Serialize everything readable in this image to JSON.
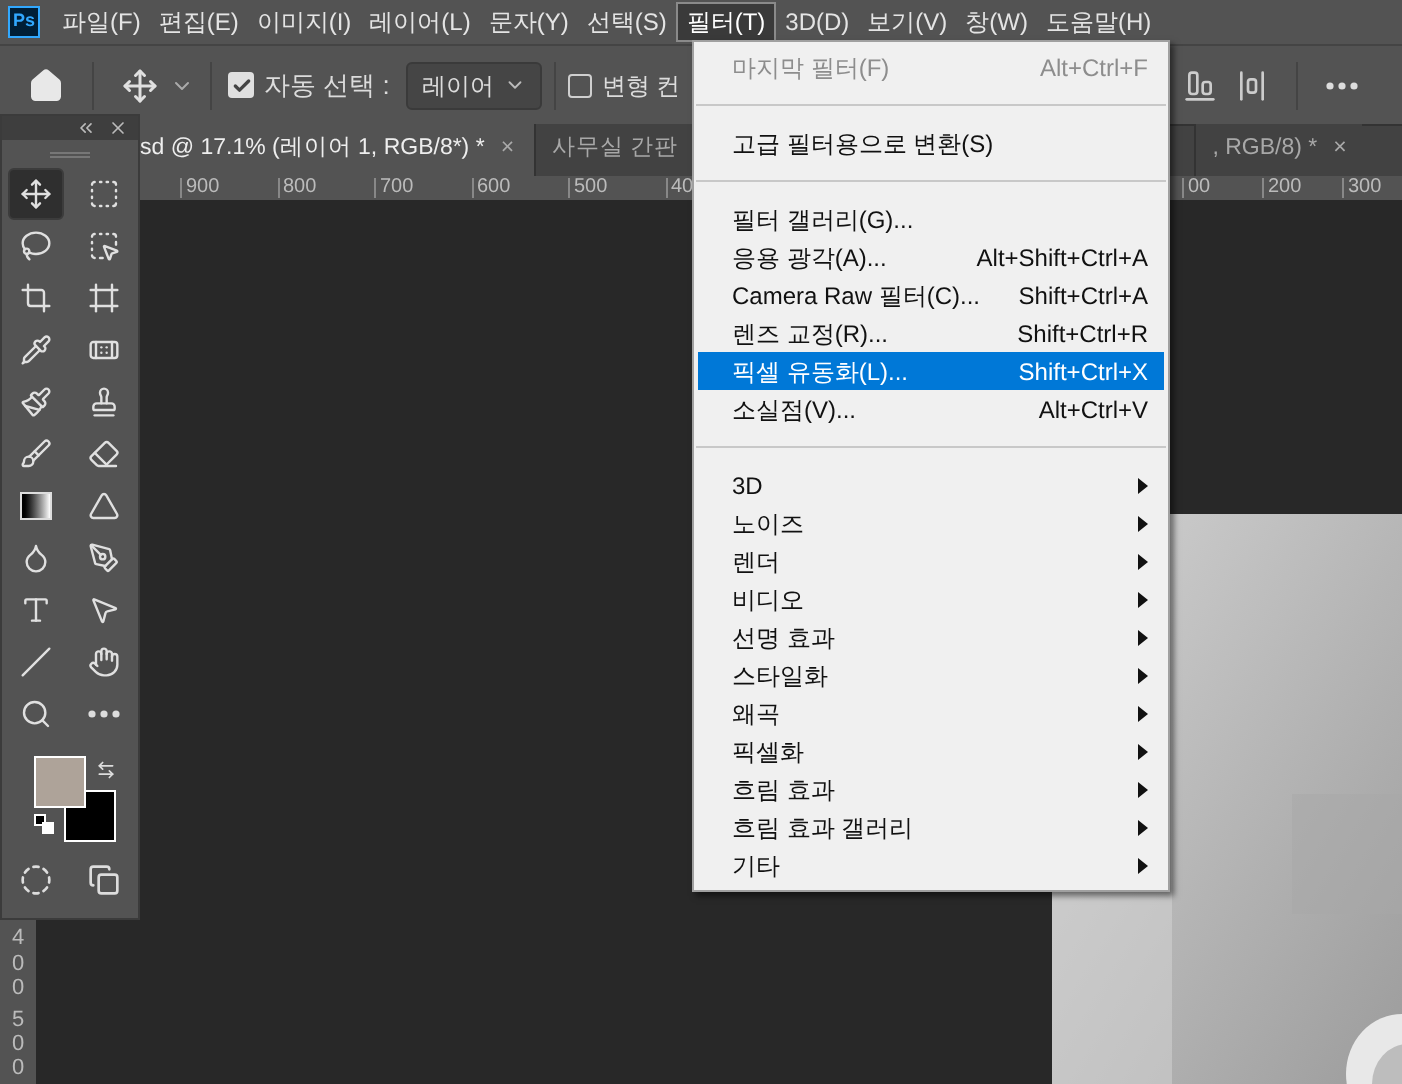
{
  "app_logo": "Ps",
  "menubar": [
    {
      "label": "파일(F)",
      "selected": false
    },
    {
      "label": "편집(E)",
      "selected": false
    },
    {
      "label": "이미지(I)",
      "selected": false
    },
    {
      "label": "레이어(L)",
      "selected": false
    },
    {
      "label": "문자(Y)",
      "selected": false
    },
    {
      "label": "선택(S)",
      "selected": false
    },
    {
      "label": "필터(T)",
      "selected": true
    },
    {
      "label": "3D(D)",
      "selected": false
    },
    {
      "label": "보기(V)",
      "selected": false
    },
    {
      "label": "창(W)",
      "selected": false
    },
    {
      "label": "도움말(H)",
      "selected": false
    }
  ],
  "options_bar": {
    "auto_select": {
      "label": "자동 선택 :",
      "checked": true
    },
    "auto_select_target": "레이어",
    "transform_controls": {
      "label": "변형 컨",
      "checked": false
    }
  },
  "document_tabs": [
    {
      "label": "sd @ 17.1% (레이어 1, RGB/8*) *",
      "close": "×",
      "selected": true
    },
    {
      "label": "사무실 간판",
      "selected": false
    },
    {
      "label": ", RGB/8) *",
      "close": "×",
      "selected": false
    }
  ],
  "ruler_left_labels": [
    "900",
    "800",
    "700",
    "600",
    "500",
    "40"
  ],
  "ruler_right_labels": [
    "00",
    "200",
    "300"
  ],
  "vertical_ruler_labels": [
    "400",
    "500"
  ],
  "toolbox": {
    "tools": [
      {
        "kind": "move",
        "selected": true
      },
      {
        "kind": "marquee",
        "selected": false
      },
      {
        "kind": "lasso",
        "selected": false
      },
      {
        "kind": "object-select",
        "selected": false
      },
      {
        "kind": "crop",
        "selected": false
      },
      {
        "kind": "frame",
        "selected": false
      },
      {
        "kind": "eyedropper",
        "selected": false
      },
      {
        "kind": "patch",
        "selected": false
      },
      {
        "kind": "brush",
        "selected": false
      },
      {
        "kind": "stamp",
        "selected": false
      },
      {
        "kind": "history-brush",
        "selected": false
      },
      {
        "kind": "eraser",
        "selected": false
      },
      {
        "kind": "gradient",
        "selected": false
      },
      {
        "kind": "triangle",
        "selected": false
      },
      {
        "kind": "smudge",
        "selected": false
      },
      {
        "kind": "pen",
        "selected": false
      },
      {
        "kind": "type",
        "selected": false
      },
      {
        "kind": "pointer",
        "selected": false
      },
      {
        "kind": "line",
        "selected": false
      },
      {
        "kind": "hand",
        "selected": false
      },
      {
        "kind": "zoom",
        "selected": false
      },
      {
        "kind": "more",
        "selected": false
      }
    ]
  },
  "filter_menu": [
    {
      "kind": "item",
      "label": "마지막 필터(F)",
      "shortcut": "Alt+Ctrl+F",
      "disabled": true,
      "selected": false
    },
    {
      "kind": "separator"
    },
    {
      "kind": "item",
      "label": "고급 필터용으로 변환(S)",
      "disabled": false,
      "selected": false
    },
    {
      "kind": "separator"
    },
    {
      "kind": "item",
      "label": "필터 갤러리(G)...",
      "disabled": false,
      "selected": false
    },
    {
      "kind": "item",
      "label": "응용 광각(A)...",
      "shortcut": "Alt+Shift+Ctrl+A",
      "disabled": false,
      "selected": false
    },
    {
      "kind": "item",
      "label": "Camera Raw 필터(C)...",
      "shortcut": "Shift+Ctrl+A",
      "disabled": false,
      "selected": false
    },
    {
      "kind": "item",
      "label": "렌즈 교정(R)...",
      "shortcut": "Shift+Ctrl+R",
      "disabled": false,
      "selected": false
    },
    {
      "kind": "item",
      "label": "픽셀 유동화(L)...",
      "shortcut": "Shift+Ctrl+X",
      "disabled": false,
      "selected": true
    },
    {
      "kind": "item",
      "label": "소실점(V)...",
      "shortcut": "Alt+Ctrl+V",
      "disabled": false,
      "selected": false
    },
    {
      "kind": "separator"
    },
    {
      "kind": "submenu",
      "label": "3D",
      "selected": false
    },
    {
      "kind": "submenu",
      "label": "노이즈",
      "selected": false
    },
    {
      "kind": "submenu",
      "label": "렌더",
      "selected": false
    },
    {
      "kind": "submenu",
      "label": "비디오",
      "selected": false
    },
    {
      "kind": "submenu",
      "label": "선명 효과",
      "selected": false
    },
    {
      "kind": "submenu",
      "label": "스타일화",
      "selected": false
    },
    {
      "kind": "submenu",
      "label": "왜곡",
      "selected": false
    },
    {
      "kind": "submenu",
      "label": "픽셀화",
      "selected": false
    },
    {
      "kind": "submenu",
      "label": "흐림 효과",
      "selected": false
    },
    {
      "kind": "submenu",
      "label": "흐림 효과 갤러리",
      "selected": false
    },
    {
      "kind": "submenu",
      "label": "기타",
      "selected": false
    }
  ],
  "canvas": {
    "kind": "picture"
  }
}
